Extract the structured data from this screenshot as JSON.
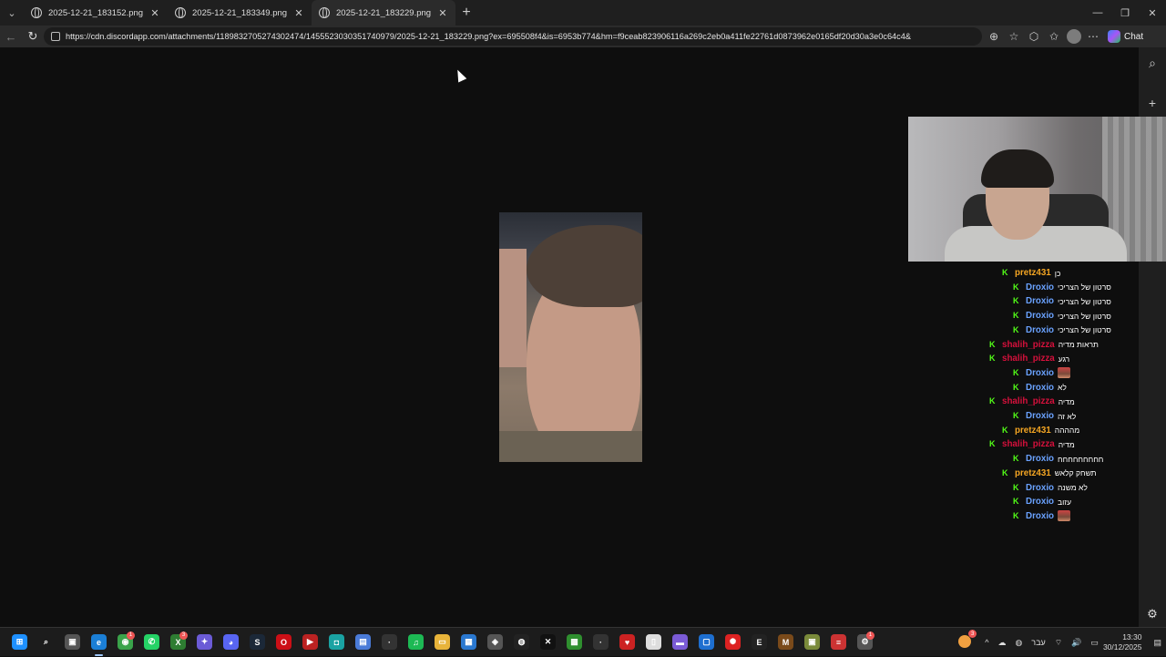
{
  "browser": {
    "tabs": [
      {
        "title": "2025-12-21_183152.png (278×267)",
        "active": false
      },
      {
        "title": "2025-12-21_183349.png (86×108)",
        "active": false
      },
      {
        "title": "2025-12-21_183229.png (156×274)",
        "active": true
      }
    ],
    "url": "https://cdn.discordapp.com/attachments/1189832705274302474/1455523030351740979/2025-12-21_183229.png?ex=695508f4&is=6953b774&hm=f9ceab823906116a269c2eb0a411fe22761d0873962e0165df20d30a3e0c64c4&",
    "chat_button": "Chat"
  },
  "chat": {
    "colors": {
      "pretz431": "#f5a623",
      "Droxio": "#6aa2ff",
      "shalih_pizza": "#d6103c",
      "badge": "#53fc18"
    },
    "messages": [
      {
        "user": "pretz431",
        "text": "כן",
        "emote": false
      },
      {
        "user": "Droxio",
        "text": "סרטון של הצריכי",
        "emote": false
      },
      {
        "user": "Droxio",
        "text": "סרטון של הצריכי",
        "emote": false
      },
      {
        "user": "Droxio",
        "text": "סרטון של הצריכי",
        "emote": false
      },
      {
        "user": "Droxio",
        "text": "סרטון של הצריכי",
        "emote": false
      },
      {
        "user": "shalih_pizza",
        "text": "תראות מדיה",
        "emote": false
      },
      {
        "user": "shalih_pizza",
        "text": "רגע",
        "emote": false
      },
      {
        "user": "Droxio",
        "text": "",
        "emote": true
      },
      {
        "user": "Droxio",
        "text": "לא",
        "emote": false
      },
      {
        "user": "shalih_pizza",
        "text": "מדיה",
        "emote": false
      },
      {
        "user": "Droxio",
        "text": "לא זה",
        "emote": false
      },
      {
        "user": "pretz431",
        "text": "מהההה",
        "emote": false
      },
      {
        "user": "shalih_pizza",
        "text": "מדיה",
        "emote": false
      },
      {
        "user": "Droxio",
        "text": "חחחחחחחחח",
        "emote": false
      },
      {
        "user": "pretz431",
        "text": "תשחק קלאש",
        "emote": false
      },
      {
        "user": "Droxio",
        "text": "לא משנה",
        "emote": false
      },
      {
        "user": "Droxio",
        "text": "עזוב",
        "emote": false
      },
      {
        "user": "Droxio",
        "text": "",
        "emote": true
      }
    ]
  },
  "taskbar": {
    "icons": [
      {
        "name": "start",
        "glyph": "⊞",
        "color": "#1e90ff"
      },
      {
        "name": "search",
        "glyph": "⌕",
        "color": "transparent"
      },
      {
        "name": "task-view",
        "glyph": "▣",
        "color": "#555"
      },
      {
        "name": "edge",
        "glyph": "e",
        "color": "#1b7fd6"
      },
      {
        "name": "chrome",
        "glyph": "◉",
        "color": "#3aa34a"
      },
      {
        "name": "whatsapp",
        "glyph": "✆",
        "color": "#25d366"
      },
      {
        "name": "xbox",
        "glyph": "X",
        "color": "#2e7d32"
      },
      {
        "name": "copilot",
        "glyph": "✦",
        "color": "#6b5bd6"
      },
      {
        "name": "discord",
        "glyph": "◕",
        "color": "#5865f2"
      },
      {
        "name": "steam",
        "glyph": "S",
        "color": "#1b2838"
      },
      {
        "name": "opera",
        "glyph": "O",
        "color": "#cc0f16"
      },
      {
        "name": "media-player",
        "glyph": "▶",
        "color": "#b22"
      },
      {
        "name": "app-teal",
        "glyph": "◘",
        "color": "#1aa3a3"
      },
      {
        "name": "store",
        "glyph": "▤",
        "color": "#4a7bd8"
      },
      {
        "name": "app-dark",
        "glyph": "·",
        "color": "#333"
      },
      {
        "name": "spotify",
        "glyph": "♫",
        "color": "#1db954"
      },
      {
        "name": "file-explorer",
        "glyph": "▭",
        "color": "#e8b43a"
      },
      {
        "name": "app-blue",
        "glyph": "▦",
        "color": "#2a78d0"
      },
      {
        "name": "shield",
        "glyph": "◈",
        "color": "#555"
      },
      {
        "name": "app-circle",
        "glyph": "◍",
        "color": "#222"
      },
      {
        "name": "capcut",
        "glyph": "✕",
        "color": "#111"
      },
      {
        "name": "minecraft",
        "glyph": "▩",
        "color": "#2f8f2f"
      },
      {
        "name": "app-dim",
        "glyph": "·",
        "color": "#333"
      },
      {
        "name": "heart-app",
        "glyph": "♥",
        "color": "#c22"
      },
      {
        "name": "notepad",
        "glyph": "▯",
        "color": "#ddd"
      },
      {
        "name": "clapper",
        "glyph": "▬",
        "color": "#7b5bd6"
      },
      {
        "name": "app-window",
        "glyph": "▢",
        "color": "#1e6fd0"
      },
      {
        "name": "app-red",
        "glyph": "✺",
        "color": "#d22"
      },
      {
        "name": "epic-games",
        "glyph": "E",
        "color": "#222"
      },
      {
        "name": "app-brown",
        "glyph": "M",
        "color": "#7a4a1a"
      },
      {
        "name": "minecraft-alt",
        "glyph": "▣",
        "color": "#7a8a3a"
      },
      {
        "name": "app-stack",
        "glyph": "≡",
        "color": "#c33"
      },
      {
        "name": "settings-app",
        "glyph": "⚙",
        "color": "#555"
      }
    ],
    "badges": {
      "chrome": "1",
      "xbox": "3",
      "settings-app": "1",
      "weather": "3"
    },
    "tray": {
      "chevron": "^",
      "lang": "עבר",
      "time": "13:30",
      "date": "30/12/2025"
    }
  }
}
